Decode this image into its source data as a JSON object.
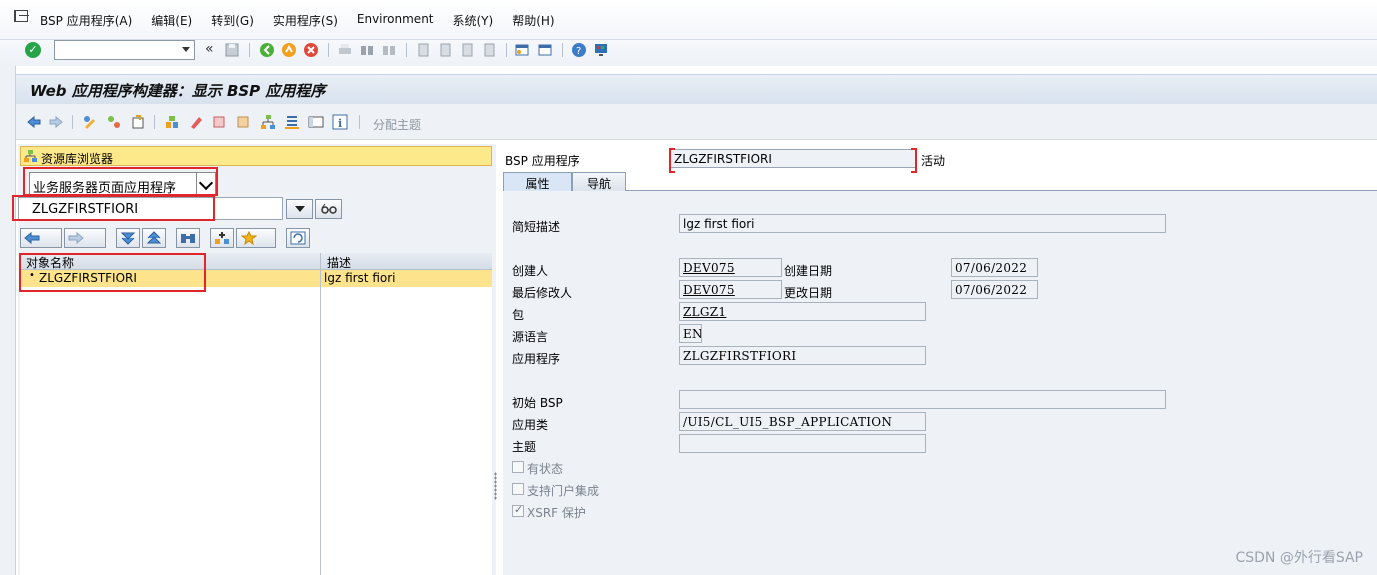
{
  "menu": {
    "items": [
      "BSP 应用程序(A)",
      "编辑(E)",
      "转到(G)",
      "实用程序(S)",
      "Environment",
      "系统(Y)",
      "帮助(H)"
    ]
  },
  "toolbar": {
    "command_field_value": "",
    "nav_back_glyph": "«"
  },
  "title": "Web 应用程序构建器：显示 BSP 应用程序",
  "app_toolbar": {
    "theme_button": "分配主题"
  },
  "repository": {
    "header": "资源库浏览器",
    "object_type": "业务服务器页面应用程序",
    "object_name": "ZLGZFIRSTFIORI",
    "columns": [
      "对象名称",
      "描述"
    ],
    "rows": [
      {
        "name": "ZLGZFIRSTFIORI",
        "description": "lgz first fiori"
      }
    ]
  },
  "detail": {
    "app_label": "BSP 应用程序",
    "app_name": "ZLGZFIRSTFIORI",
    "status": "活动",
    "tabs": [
      "属性",
      "导航"
    ],
    "fields": {
      "short_desc_label": "简短描述",
      "short_desc": "lgz first fiori",
      "created_by_label": "创建人",
      "created_by": "DEV075",
      "created_on_label": "创建日期",
      "created_on": "07/06/2022",
      "changed_by_label": "最后修改人",
      "changed_by": "DEV075",
      "changed_on_label": "更改日期",
      "changed_on": "07/06/2022",
      "package_label": "包",
      "package": "ZLGZ1",
      "orig_lang_label": "源语言",
      "orig_lang": "EN",
      "application_label": "应用程序",
      "application": "ZLGZFIRSTFIORI",
      "initial_bsp_label": "初始 BSP",
      "initial_bsp": "",
      "app_class_label": "应用类",
      "app_class": "/UI5/CL_UI5_BSP_APPLICATION",
      "theme_label": "主题",
      "theme": ""
    },
    "checkboxes": [
      {
        "label": "有状态",
        "checked": false
      },
      {
        "label": "支持门户集成",
        "checked": false
      },
      {
        "label": "XSRF 保护",
        "checked": true
      }
    ]
  },
  "watermark": "CSDN @外行看SAP",
  "colors": {
    "highlight_row": "#fde48c",
    "annotation_red": "#e0262a",
    "panel_bg": "#eef2f7"
  }
}
